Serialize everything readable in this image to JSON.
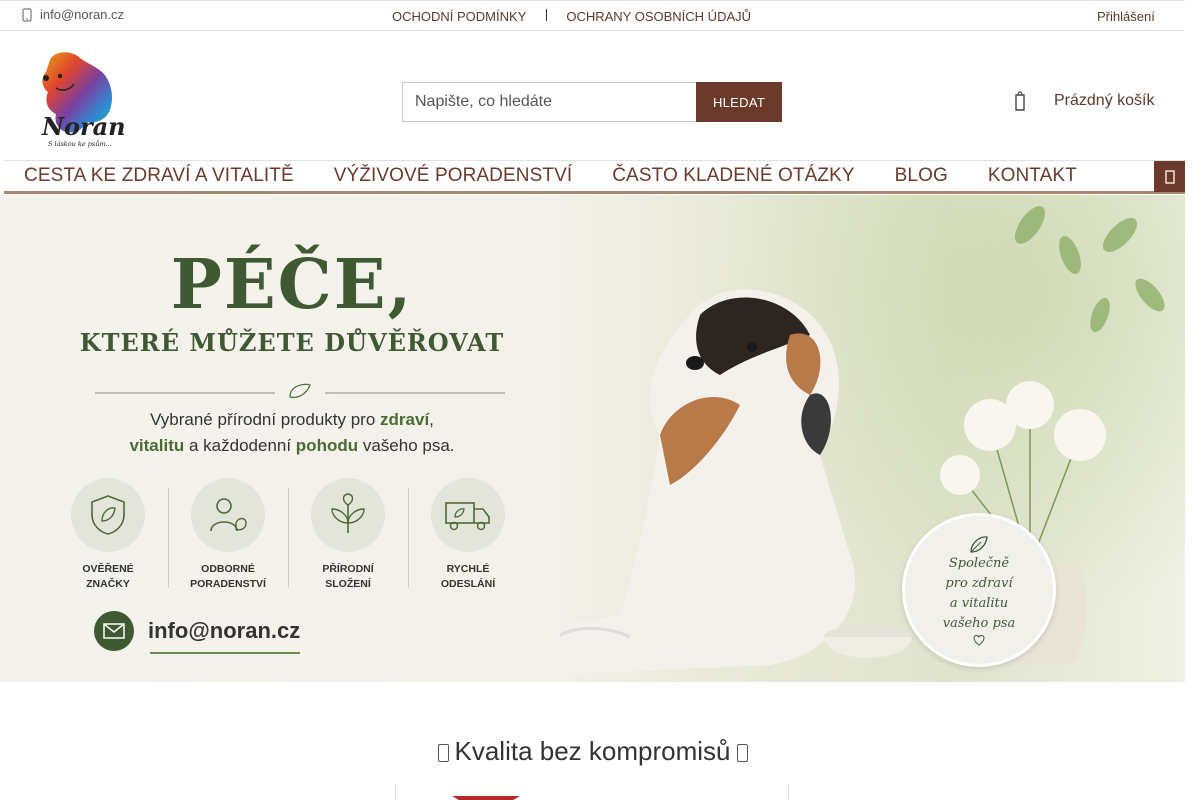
{
  "topbar": {
    "email": "info@noran.cz",
    "links": [
      "OCHODNÍ PODMÍNKY",
      "OCHRANY OSOBNÍCH ÚDAJŮ"
    ],
    "login": "Přihlášení"
  },
  "logo": {
    "brand": "Noran",
    "slogan": "S láskou ke psům..."
  },
  "search": {
    "placeholder": "Napište, co hledáte",
    "button": "HLEDAT"
  },
  "cart": {
    "label": "Prázdný košík",
    "icon": "cart-icon"
  },
  "nav": {
    "items": [
      "CESTA KE ZDRAVÍ A VITALITĚ",
      "VÝŽIVOVÉ PORADENSTVÍ",
      "ČASTO KLADENÉ OTÁZKY",
      "BLOG",
      "KONTAKT"
    ],
    "menu_icon": "menu-icon"
  },
  "hero": {
    "headline": "PÉČE,",
    "subheadline": "KTERÉ MŮŽETE DŮVĚŘOVAT",
    "tagline_parts": {
      "p1": "Vybrané přírodní produkty pro ",
      "b1": "zdraví",
      "p2": ",",
      "b2": "vitalitu",
      "p3": " a každodenní ",
      "b3": "pohodu",
      "p4": " vašeho psa."
    },
    "features": [
      {
        "line1": "OVĚŘENÉ",
        "line2": "ZNAČKY",
        "icon": "shield-leaf-icon"
      },
      {
        "line1": "ODBORNÉ",
        "line2": "PORADENSTVÍ",
        "icon": "person-dog-icon"
      },
      {
        "line1": "PŘÍRODNÍ",
        "line2": "SLOŽENÍ",
        "icon": "plant-icon"
      },
      {
        "line1": "RYCHLÉ",
        "line2": "ODESLÁNÍ",
        "icon": "truck-icon"
      }
    ],
    "email": "info@noran.cz",
    "badge": [
      "Společně",
      "pro zdraví",
      "a vitalitu",
      "vašeho psa"
    ],
    "colors": {
      "green": "#3f5a33",
      "brown": "#6b3a2a"
    }
  },
  "section": {
    "title": "Kvalita bez kompromisů"
  }
}
